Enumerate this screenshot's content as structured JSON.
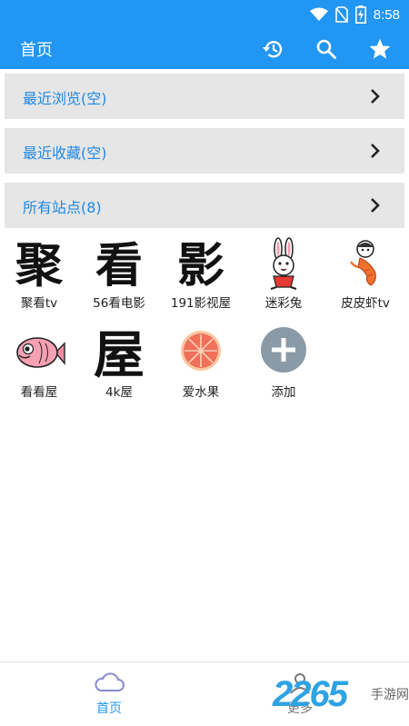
{
  "status_bar": {
    "time": "8:58"
  },
  "app_bar": {
    "title": "首页"
  },
  "sections": [
    {
      "label": "最近浏览(空)"
    },
    {
      "label": "最近收藏(空)"
    },
    {
      "label": "所有站点(8)"
    }
  ],
  "sites": [
    {
      "name": "聚看tv",
      "glyph": "聚"
    },
    {
      "name": "56看电影",
      "glyph": "看"
    },
    {
      "name": "191影视屋",
      "glyph": "影"
    },
    {
      "name": "迷彩兔",
      "icon": "rabbit-icon"
    },
    {
      "name": "皮皮虾tv",
      "icon": "shrimp-icon"
    },
    {
      "name": "看看屋",
      "icon": "fish-icon"
    },
    {
      "name": "4k屋",
      "glyph": "屋"
    },
    {
      "name": "爱水果",
      "icon": "grapefruit-icon"
    },
    {
      "name": "添加",
      "icon": "plus-icon"
    }
  ],
  "bottom_nav": [
    {
      "label": "首页"
    },
    {
      "label": "更多"
    }
  ],
  "watermark": {
    "big": "2265",
    "small": "手游网"
  },
  "colors": {
    "primary": "#2196f3",
    "link": "#1e88e5",
    "section_bg": "#e6e6e6"
  }
}
